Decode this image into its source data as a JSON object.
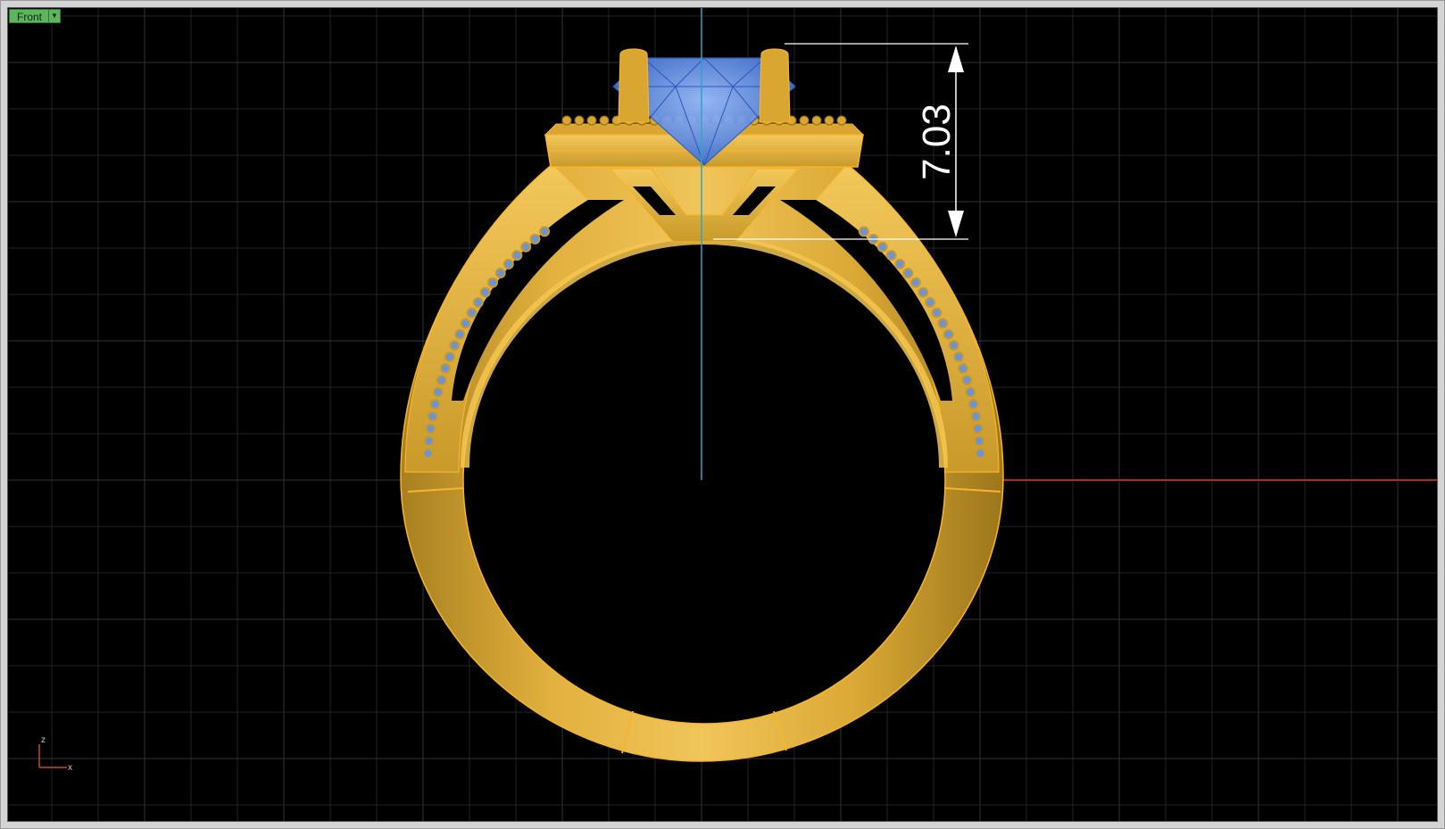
{
  "viewport": {
    "name": "Front",
    "dropdown_icon": "chevron-down-icon"
  },
  "dimension": {
    "value": "7.03"
  },
  "axes_widget": {
    "z_label": "z",
    "x_label": "x"
  },
  "colors": {
    "background": "#000000",
    "grid_line": "#262626",
    "x_axis": "#b3261e",
    "z_axis": "#2aa5c9",
    "gold": "#e0ac33",
    "gold_edge": "#f7b52a",
    "gem": "#5c8fe6",
    "dimension": "#ffffff",
    "tab": "#5fb55f"
  }
}
